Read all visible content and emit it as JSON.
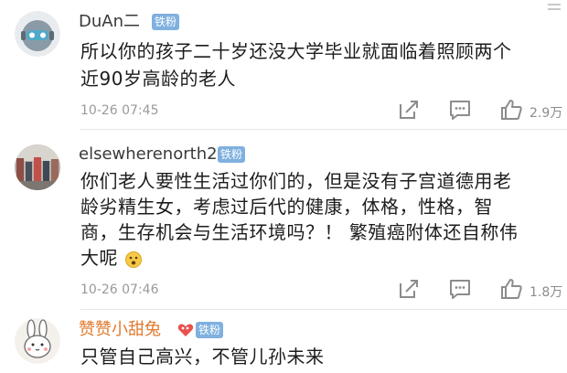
{
  "comments": [
    {
      "username": "DuAn二",
      "badge": "铁粉",
      "text_lines": [
        "所以你的孩子二十岁还没大学毕业就面临着照顾两个",
        "近90岁高龄的老人"
      ],
      "timestamp": "10-26 07:45",
      "likes": "2.9万",
      "username_color": "#3a3a3a",
      "icons": [
        "share-icon",
        "comment-icon",
        "like-icon"
      ]
    },
    {
      "username": "elsewherenorth2",
      "badge": "铁粉",
      "text_lines": [
        "你们老人要性生活过你们的，但是没有子宫道德用老",
        "龄劣精生女，考虑过后代的健康，体格，性格，智",
        "商，生存机会与生活环境吗？！ 繁殖癌附体还自称伟",
        "大呢"
      ],
      "emoji": "surprised-emoji",
      "timestamp": "10-26 07:46",
      "likes": "1.8万",
      "username_color": "#3a3a3a",
      "icons": [
        "share-icon",
        "comment-icon",
        "like-icon"
      ]
    },
    {
      "username": "赞赞小甜兔",
      "badge": "铁粉",
      "text_lines": [
        "只管自己高兴，不管儿孙未来"
      ],
      "username_color": "#e07a2e",
      "icons": [
        "heart-badge-icon"
      ]
    }
  ],
  "colors": {
    "badge_bg": "#7fb0df",
    "text": "#1c1c1c",
    "meta": "#9a9a9a",
    "divider": "#e6e6e6"
  }
}
